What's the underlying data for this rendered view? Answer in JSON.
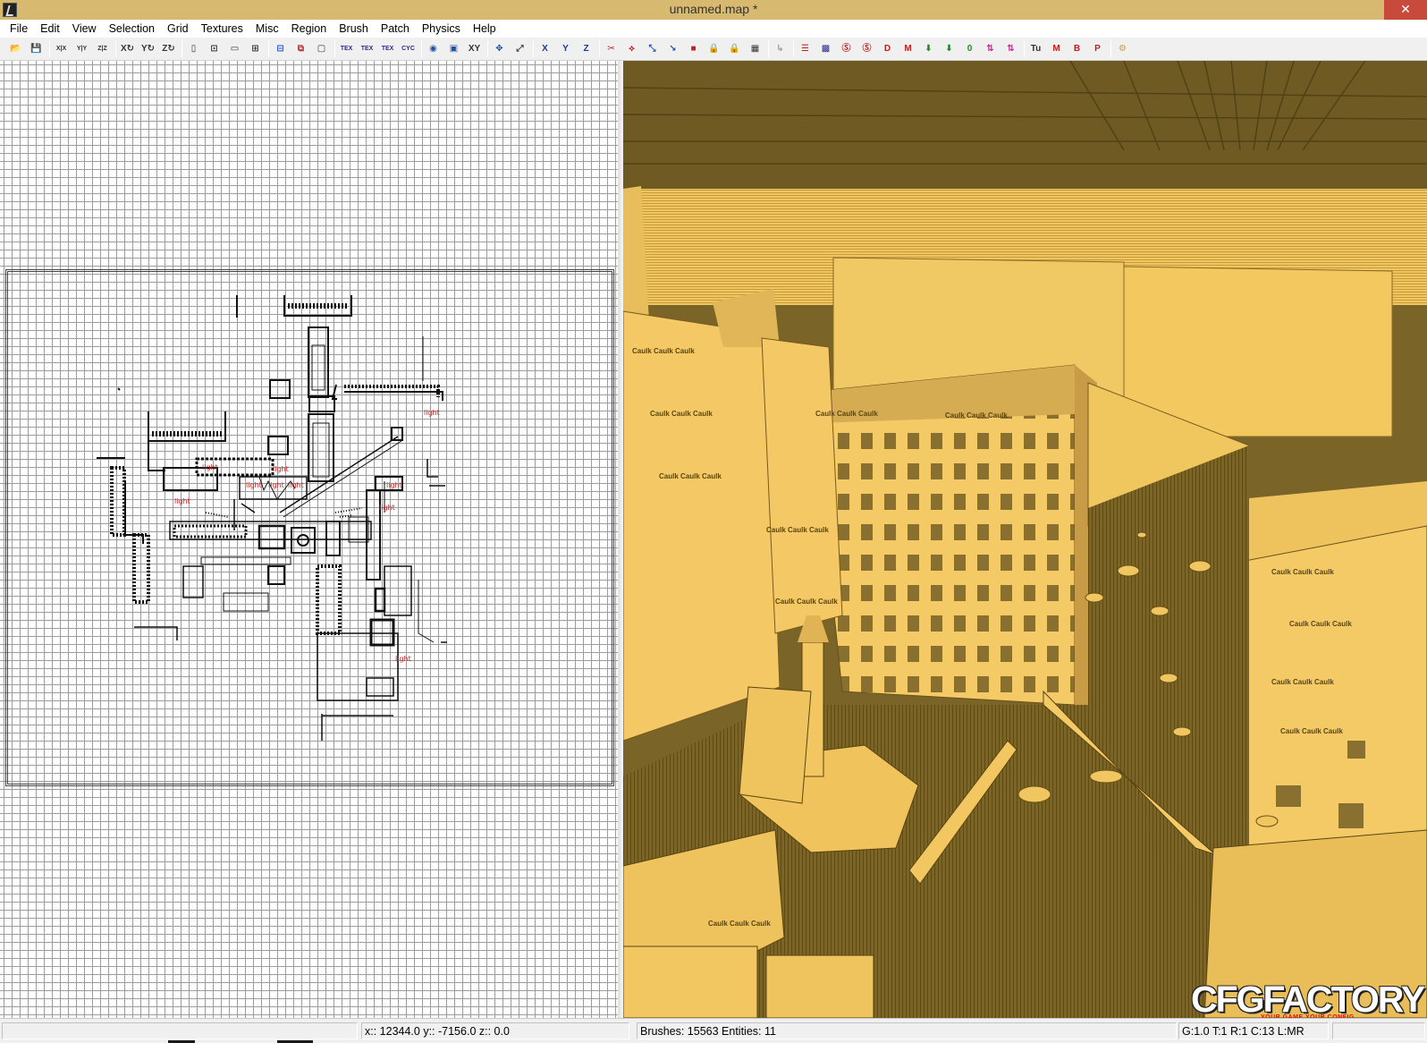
{
  "window": {
    "title": "unnamed.map *",
    "close_glyph": "✕"
  },
  "menu": [
    "File",
    "Edit",
    "View",
    "Selection",
    "Grid",
    "Textures",
    "Misc",
    "Region",
    "Brush",
    "Patch",
    "Physics",
    "Help"
  ],
  "toolbar": [
    {
      "name": "open-file-icon",
      "glyph": "📂",
      "color": "#c8a030"
    },
    {
      "name": "save-file-icon",
      "glyph": "💾",
      "color": "#333333"
    },
    {
      "sep": true
    },
    {
      "name": "flip-x-icon",
      "glyph": "X|X",
      "color": "#333333"
    },
    {
      "name": "flip-y-icon",
      "glyph": "Y|Y",
      "color": "#333333"
    },
    {
      "name": "flip-z-icon",
      "glyph": "Z|Z",
      "color": "#333333"
    },
    {
      "sep": true
    },
    {
      "name": "rotate-x-icon",
      "glyph": "X↻",
      "color": "#333333"
    },
    {
      "name": "rotate-y-icon",
      "glyph": "Y↻",
      "color": "#333333"
    },
    {
      "name": "rotate-z-icon",
      "glyph": "Z↻",
      "color": "#333333"
    },
    {
      "sep": true
    },
    {
      "name": "select-complete-tall-icon",
      "glyph": "▯",
      "color": "#333333"
    },
    {
      "name": "select-touching-icon",
      "glyph": "⊡",
      "color": "#333333"
    },
    {
      "name": "select-partial-tall-icon",
      "glyph": "▭",
      "color": "#333333"
    },
    {
      "name": "select-inside-icon",
      "glyph": "⊞",
      "color": "#333333"
    },
    {
      "sep": true
    },
    {
      "name": "csg-subtract-icon",
      "glyph": "⊟",
      "color": "#2050c0"
    },
    {
      "name": "csg-merge-icon",
      "glyph": "⧉",
      "color": "#c03030"
    },
    {
      "name": "make-hollow-icon",
      "glyph": "▢",
      "color": "#333333"
    },
    {
      "sep": true
    },
    {
      "name": "texture-flip-x-icon",
      "glyph": "TEX",
      "color": "#2a2a8a"
    },
    {
      "name": "texture-flip-y-icon",
      "glyph": "TEX",
      "color": "#2a2a8a"
    },
    {
      "name": "texture-rotate-icon",
      "glyph": "TEX",
      "color": "#2a2a8a"
    },
    {
      "name": "cycle-layer-icon",
      "glyph": "CYC",
      "color": "#2a2a8a"
    },
    {
      "sep": true
    },
    {
      "name": "camera-view-icon",
      "glyph": "◉",
      "color": "#2050a0"
    },
    {
      "name": "texture-view-icon",
      "glyph": "▣",
      "color": "#2050a0"
    },
    {
      "name": "xy-view-icon",
      "glyph": "XY",
      "color": "#333333"
    },
    {
      "sep": true
    },
    {
      "name": "change-views-icon",
      "glyph": "✥",
      "color": "#2050a0"
    },
    {
      "name": "resize-view-icon",
      "glyph": "⤢",
      "color": "#333333"
    },
    {
      "sep": true
    },
    {
      "name": "axis-x-icon",
      "glyph": "X",
      "color": "#1a3a8a"
    },
    {
      "name": "axis-y-icon",
      "glyph": "Y",
      "color": "#1a3a8a"
    },
    {
      "name": "axis-z-icon",
      "glyph": "Z",
      "color": "#1a3a8a"
    },
    {
      "sep": true
    },
    {
      "name": "clipper-icon",
      "glyph": "✂",
      "color": "#c02020"
    },
    {
      "name": "drag-edges-icon",
      "glyph": "⟡",
      "color": "#c02020"
    },
    {
      "name": "drag-vertices-icon",
      "glyph": "⤡",
      "color": "#2050a0"
    },
    {
      "name": "scale-icon",
      "glyph": "↘",
      "color": "#2050a0"
    },
    {
      "name": "show-entities-icon",
      "glyph": "■",
      "color": "#c02020"
    },
    {
      "name": "texture-lock-icon",
      "glyph": "🔒",
      "color": "#333333"
    },
    {
      "name": "rotate-lock-icon",
      "glyph": "🔒",
      "color": "#333333"
    },
    {
      "name": "brush-entity-icon",
      "glyph": "▦",
      "color": "#333333"
    },
    {
      "sep": true
    },
    {
      "name": "disabled-tool-icon",
      "glyph": "↳",
      "color": "#9a9a9a"
    },
    {
      "sep": true
    },
    {
      "name": "entity-list-icon",
      "glyph": "☰",
      "color": "#c02020"
    },
    {
      "name": "filter-patches-icon",
      "glyph": "▩",
      "color": "#2a2a8a"
    },
    {
      "name": "filter-clip-icon",
      "glyph": "Ⓢ",
      "color": "#c02020"
    },
    {
      "name": "filter-caulk-icon",
      "glyph": "Ⓢ",
      "color": "#c02020"
    },
    {
      "name": "filter-detail-icon",
      "glyph": "D",
      "color": "#c02020"
    },
    {
      "name": "filter-models-icon",
      "glyph": "M",
      "color": "#c02020"
    },
    {
      "name": "arrow-down-icon",
      "glyph": "⬇",
      "color": "#208a20"
    },
    {
      "name": "arrow-down-alt-icon",
      "glyph": "⬇",
      "color": "#208a20"
    },
    {
      "name": "zero-icon",
      "glyph": "0",
      "color": "#208a20"
    },
    {
      "name": "arrows-up-down-icon",
      "glyph": "⇅",
      "color": "#c02090"
    },
    {
      "name": "arrows-up-down-alt-icon",
      "glyph": "⇅",
      "color": "#c02090"
    },
    {
      "sep": true
    },
    {
      "name": "tu-icon",
      "glyph": "Tu",
      "color": "#333333"
    },
    {
      "name": "m-icon",
      "glyph": "M",
      "color": "#c02020"
    },
    {
      "name": "b-icon",
      "glyph": "B",
      "color": "#c02020"
    },
    {
      "name": "p-icon",
      "glyph": "P",
      "color": "#c02020"
    },
    {
      "sep": true
    },
    {
      "name": "plugin-icon",
      "glyph": "⚙",
      "color": "#c8a030"
    }
  ],
  "grid": {
    "light_label": "light"
  },
  "camera": {
    "caulk_text": "Caulk Caulk Caulk"
  },
  "logo": {
    "main": "CFGFACTORY",
    "sub": "YOUR GAME YOUR CONFIG"
  },
  "status": {
    "coords": "x:: 12344.0  y:: -7156.0  z:: 0.0",
    "counts": "Brushes: 15563 Entities: 11",
    "grid_info": "G:1.0 T:1 R:1 C:13 L:MR"
  }
}
